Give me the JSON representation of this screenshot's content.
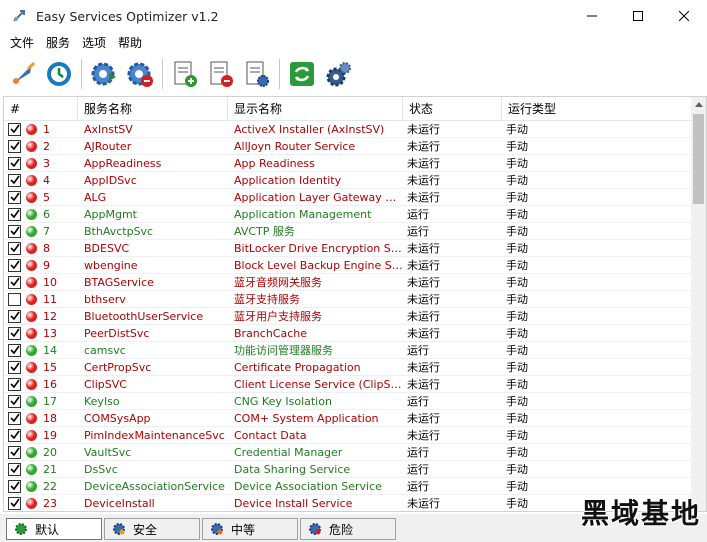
{
  "window": {
    "title": "Easy Services Optimizer v1.2"
  },
  "menu": [
    "文件",
    "服务",
    "选项",
    "帮助"
  ],
  "columns": [
    "#",
    "服务名称",
    "显示名称",
    "状态",
    "运行类型"
  ],
  "rows": [
    {
      "checked": true,
      "status": "stopped",
      "num": "1",
      "name": "AxInstSV",
      "display": "ActiveX Installer (AxInstSV)",
      "state": "未运行",
      "type": "手动"
    },
    {
      "checked": true,
      "status": "stopped",
      "num": "2",
      "name": "AJRouter",
      "display": "AllJoyn Router Service",
      "state": "未运行",
      "type": "手动"
    },
    {
      "checked": true,
      "status": "stopped",
      "num": "3",
      "name": "AppReadiness",
      "display": "App Readiness",
      "state": "未运行",
      "type": "手动"
    },
    {
      "checked": true,
      "status": "stopped",
      "num": "4",
      "name": "AppIDSvc",
      "display": "Application Identity",
      "state": "未运行",
      "type": "手动"
    },
    {
      "checked": true,
      "status": "stopped",
      "num": "5",
      "name": "ALG",
      "display": "Application Layer Gateway Ser...",
      "state": "未运行",
      "type": "手动"
    },
    {
      "checked": true,
      "status": "running",
      "num": "6",
      "name": "AppMgmt",
      "display": "Application Management",
      "state": "运行",
      "type": "手动"
    },
    {
      "checked": true,
      "status": "running",
      "num": "7",
      "name": "BthAvctpSvc",
      "display": "AVCTP 服务",
      "state": "运行",
      "type": "手动"
    },
    {
      "checked": true,
      "status": "stopped",
      "num": "8",
      "name": "BDESVC",
      "display": "BitLocker Drive Encryption Service",
      "state": "未运行",
      "type": "手动"
    },
    {
      "checked": true,
      "status": "stopped",
      "num": "9",
      "name": "wbengine",
      "display": "Block Level Backup Engine Service",
      "state": "未运行",
      "type": "手动"
    },
    {
      "checked": true,
      "status": "stopped",
      "num": "10",
      "name": "BTAGService",
      "display": "蓝牙音频网关服务",
      "state": "未运行",
      "type": "手动"
    },
    {
      "checked": false,
      "status": "stopped",
      "num": "11",
      "name": "bthserv",
      "display": "蓝牙支持服务",
      "state": "未运行",
      "type": "手动"
    },
    {
      "checked": true,
      "status": "stopped",
      "num": "12",
      "name": "BluetoothUserService",
      "display": "蓝牙用户支持服务",
      "state": "未运行",
      "type": "手动"
    },
    {
      "checked": true,
      "status": "stopped",
      "num": "13",
      "name": "PeerDistSvc",
      "display": "BranchCache",
      "state": "未运行",
      "type": "手动"
    },
    {
      "checked": true,
      "status": "running",
      "num": "14",
      "name": "camsvc",
      "display": "功能访问管理器服务",
      "state": "运行",
      "type": "手动"
    },
    {
      "checked": true,
      "status": "stopped",
      "num": "15",
      "name": "CertPropSvc",
      "display": "Certificate Propagation",
      "state": "未运行",
      "type": "手动"
    },
    {
      "checked": true,
      "status": "stopped",
      "num": "16",
      "name": "ClipSVC",
      "display": "Client License Service (ClipSVC)",
      "state": "未运行",
      "type": "手动"
    },
    {
      "checked": true,
      "status": "running",
      "num": "17",
      "name": "KeyIso",
      "display": "CNG Key Isolation",
      "state": "运行",
      "type": "手动"
    },
    {
      "checked": true,
      "status": "stopped",
      "num": "18",
      "name": "COMSysApp",
      "display": "COM+ System Application",
      "state": "未运行",
      "type": "手动"
    },
    {
      "checked": true,
      "status": "stopped",
      "num": "19",
      "name": "PimIndexMaintenanceSvc",
      "display": "Contact Data",
      "state": "未运行",
      "type": "手动"
    },
    {
      "checked": true,
      "status": "running",
      "num": "20",
      "name": "VaultSvc",
      "display": "Credential Manager",
      "state": "运行",
      "type": "手动"
    },
    {
      "checked": true,
      "status": "running",
      "num": "21",
      "name": "DsSvc",
      "display": "Data Sharing Service",
      "state": "运行",
      "type": "手动"
    },
    {
      "checked": true,
      "status": "running",
      "num": "22",
      "name": "DeviceAssociationService",
      "display": "Device Association Service",
      "state": "运行",
      "type": "手动"
    },
    {
      "checked": true,
      "status": "stopped",
      "num": "23",
      "name": "DeviceInstall",
      "display": "Device Install Service",
      "state": "未运行",
      "type": "手动"
    }
  ],
  "tabs": [
    "默认",
    "安全",
    "中等",
    "危险"
  ],
  "watermark": "黑域基地",
  "colors": {
    "stopped": "#e02020",
    "running": "#2ea82e",
    "stopped_text": "#b00000",
    "running_text": "#1f7d1f"
  }
}
